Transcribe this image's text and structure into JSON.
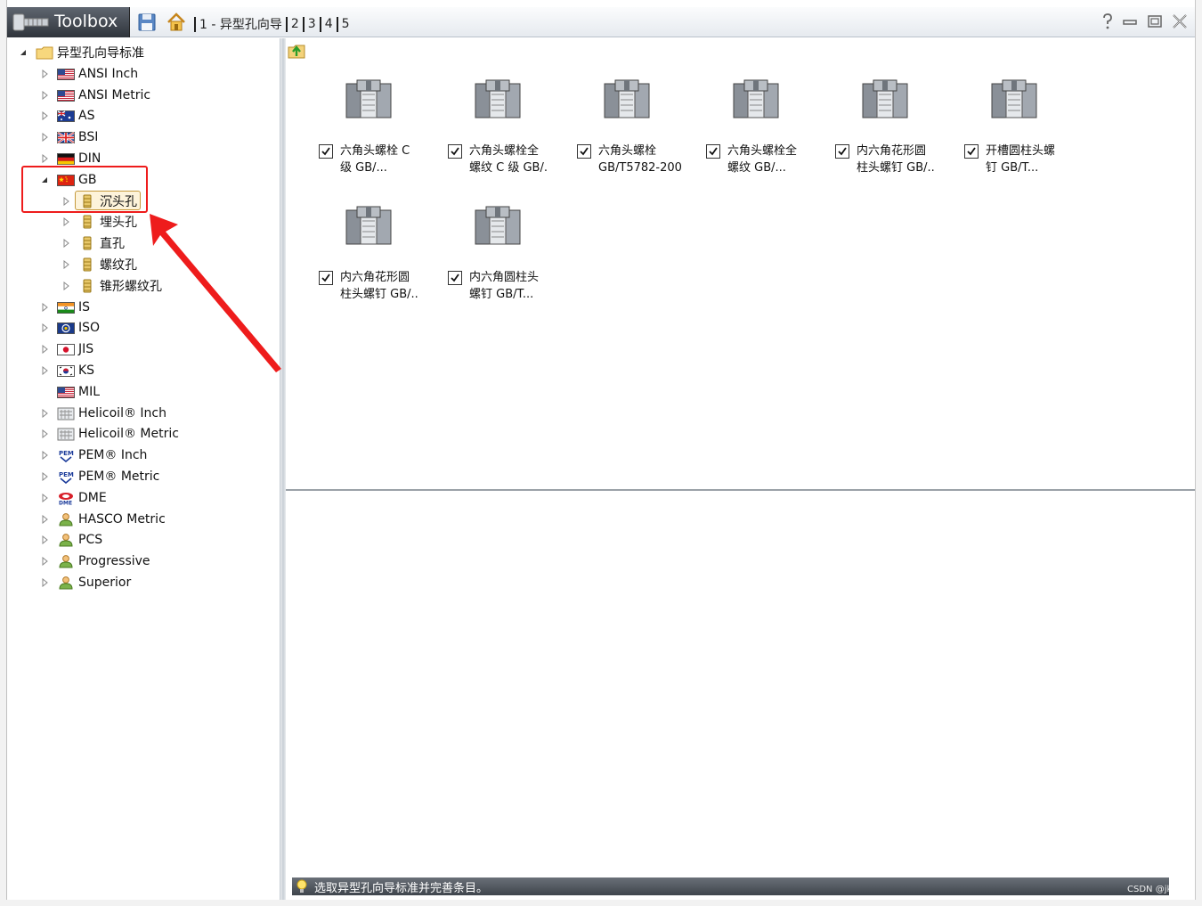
{
  "titlebar": {
    "app_name": "Toolbox",
    "breadcrumbs": [
      "1 - 异型孔向导",
      "2",
      "3",
      "4",
      "5"
    ]
  },
  "tree": [
    {
      "label": "异型孔向导标准",
      "icon": "folder-icon",
      "level": 0,
      "expanded": true
    },
    {
      "label": "ANSI Inch",
      "icon": "us-flag-icon",
      "level": 1
    },
    {
      "label": "ANSI Metric",
      "icon": "us-flag-icon",
      "level": 1
    },
    {
      "label": "AS",
      "icon": "au-flag-icon",
      "level": 1
    },
    {
      "label": "BSI",
      "icon": "uk-flag-icon",
      "level": 1
    },
    {
      "label": "DIN",
      "icon": "de-flag-icon",
      "level": 1
    },
    {
      "label": "GB",
      "icon": "cn-flag-icon",
      "level": 1,
      "expanded": true
    },
    {
      "label": "沉头孔",
      "icon": "countersink-hole-icon",
      "level": 2,
      "selected": true
    },
    {
      "label": "埋头孔",
      "icon": "counterbore-hole-icon",
      "level": 2
    },
    {
      "label": "直孔",
      "icon": "straight-hole-icon",
      "level": 2
    },
    {
      "label": "螺纹孔",
      "icon": "tapped-hole-icon",
      "level": 2
    },
    {
      "label": "锥形螺纹孔",
      "icon": "tapered-tap-hole-icon",
      "level": 2
    },
    {
      "label": "IS",
      "icon": "in-flag-icon",
      "level": 1
    },
    {
      "label": "ISO",
      "icon": "iso-flag-icon",
      "level": 1
    },
    {
      "label": "JIS",
      "icon": "jp-flag-icon",
      "level": 1
    },
    {
      "label": "KS",
      "icon": "kr-flag-icon",
      "level": 1
    },
    {
      "label": "MIL",
      "icon": "us-flag-icon",
      "level": 1,
      "no_caret": true
    },
    {
      "label": "Helicoil® Inch",
      "icon": "helicoil-icon",
      "level": 1
    },
    {
      "label": "Helicoil® Metric",
      "icon": "helicoil-icon",
      "level": 1
    },
    {
      "label": "PEM® Inch",
      "icon": "pem-icon",
      "level": 1
    },
    {
      "label": "PEM® Metric",
      "icon": "pem-icon",
      "level": 1
    },
    {
      "label": "DME",
      "icon": "dme-icon",
      "level": 1
    },
    {
      "label": "HASCO Metric",
      "icon": "person-icon",
      "level": 1
    },
    {
      "label": "PCS",
      "icon": "person-icon",
      "level": 1
    },
    {
      "label": "Progressive",
      "icon": "person-icon",
      "level": 1
    },
    {
      "label": "Superior",
      "icon": "person-icon",
      "level": 1
    }
  ],
  "items": [
    {
      "line1": "六角头螺栓 C",
      "line2": "级 GB/...",
      "checked": true
    },
    {
      "line1": "六角头螺栓全",
      "line2": "螺纹 C 级 GB/.",
      "checked": true
    },
    {
      "line1": "六角头螺栓",
      "line2": "GB/T5782-200",
      "checked": true
    },
    {
      "line1": "六角头螺栓全",
      "line2": "螺纹 GB/...",
      "checked": true
    },
    {
      "line1": "内六角花形圆",
      "line2": "柱头螺钉 GB/..",
      "checked": true
    },
    {
      "line1": "开槽圆柱头螺",
      "line2": "钉 GB/T...",
      "checked": true
    },
    {
      "line1": "内六角花形圆",
      "line2": "柱头螺钉 GB/..",
      "checked": true
    },
    {
      "line1": "内六角圆柱头",
      "line2": "螺钉 GB/T...",
      "checked": true
    }
  ],
  "status": {
    "text": "选取异型孔向导标准并完善条目。"
  },
  "watermark": "CSDN @jkeggg",
  "colors": {
    "annotation": "#ee1c1c",
    "selection_bg": "#fdf3da",
    "status_bg": "#4f555c"
  }
}
